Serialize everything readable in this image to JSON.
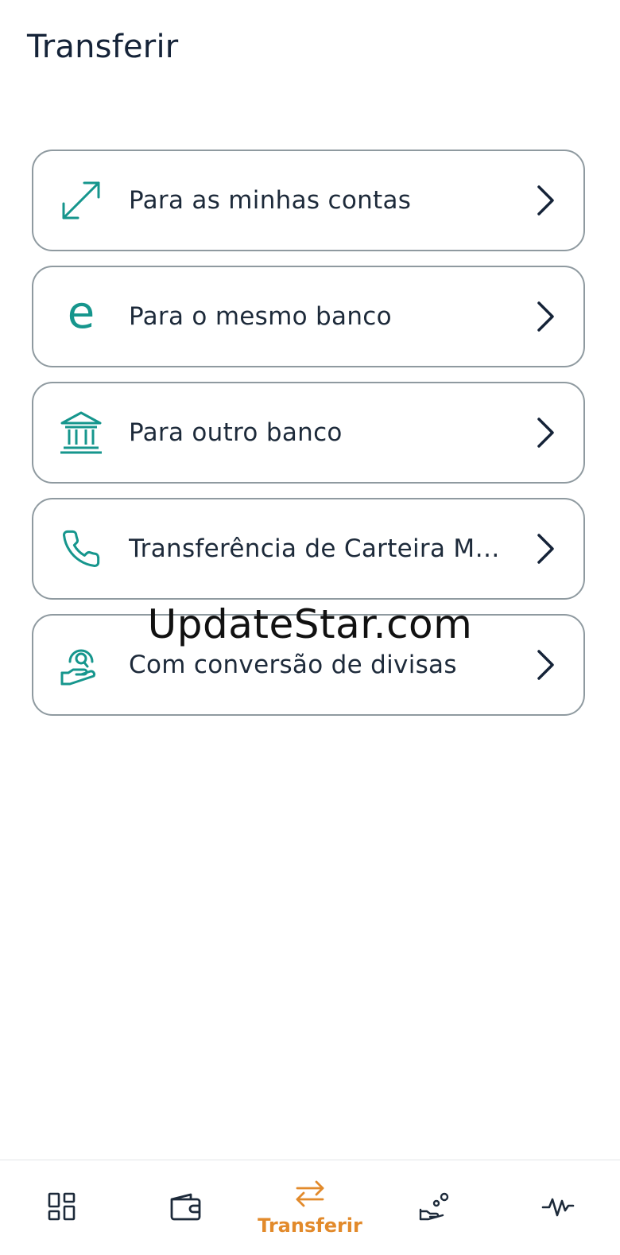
{
  "header": {
    "title": "Transferir"
  },
  "options": [
    {
      "label": "Para as minhas contas",
      "icon": "arrows-expand-icon"
    },
    {
      "label": "Para o mesmo banco",
      "icon": "bank-e-logo-icon"
    },
    {
      "label": "Para outro banco",
      "icon": "bank-building-icon"
    },
    {
      "label": "Transferência de Carteira Móvel",
      "icon": "phone-icon"
    },
    {
      "label": "Com conversão de divisas",
      "icon": "currency-hand-icon"
    }
  ],
  "watermark": "UpdateStar.com",
  "bottom_nav": {
    "items": [
      {
        "icon": "dashboard-grid-icon",
        "label": ""
      },
      {
        "icon": "wallet-icon",
        "label": ""
      },
      {
        "icon": "transfer-arrows-icon",
        "label": "Transferir",
        "active": true
      },
      {
        "icon": "payments-hand-icon",
        "label": ""
      },
      {
        "icon": "activity-icon",
        "label": ""
      }
    ]
  },
  "colors": {
    "accent": "#16968d",
    "active_nav": "#e28a2b",
    "text": "#1d2a3a",
    "border": "#8f9aa0"
  }
}
